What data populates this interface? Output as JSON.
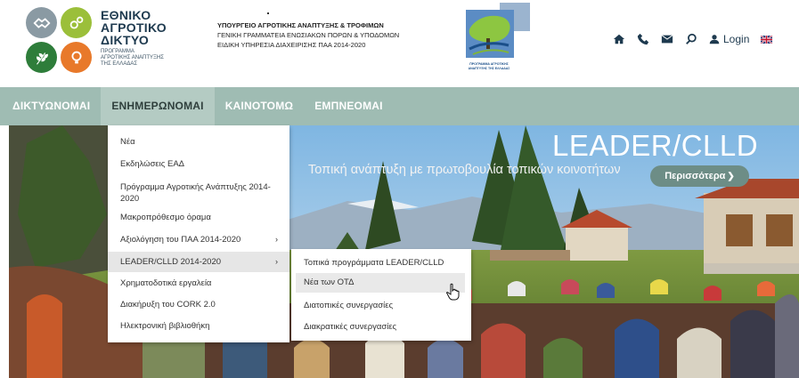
{
  "header": {
    "logo_title": [
      "ΕΘΝΙΚΟ",
      "ΑΓΡΟΤΙΚΟ",
      "ΔΙΚΤΥΟ"
    ],
    "logo_subtitle": [
      "ΠΡΟΓΡΑΜΜΑ",
      "ΑΓΡΟΤΙΚΗΣ ΑΝΑΠΤΥΞΗΣ",
      "ΤΗΣ ΕΛΛΑΔΑΣ"
    ],
    "ministry_line1": "ΥΠΟΥΡΓΕΙΟ ΑΓΡΟΤΙΚΗΣ ΑΝΑΠΤΥΞΗΣ & ΤΡΟΦΙΜΩΝ",
    "ministry_line2": "ΓΕΝΙΚΗ ΓΡΑΜΜΑΤΕΙΑ ΕΝΩΣΙΑΚΩΝ ΠΟΡΩΝ & ΥΠΟΔΟΜΩΝ",
    "ministry_line3": "ΕΙΔΙΚΗ ΥΠΗΡΕΣΙΑ ΔΙΑΧΕΙΡΙΣΗΣ ΠΑΑ 2014-2020",
    "emblem_caption": "ΠΡΟΓΡΑΜΜΑ ΑΓΡΟΤΙΚΗΣ ΑΝΑΠΤΥΞΗΣ ΤΗΣ ΕΛΛΑΔΑΣ",
    "login_label": "Login",
    "icons": [
      "home-icon",
      "phone-icon",
      "mail-icon",
      "search-icon",
      "user-icon",
      "uk-flag-icon"
    ],
    "logo_colors": [
      "#8a9aa3",
      "#9bbf3a",
      "#2e7d3a",
      "#e8792a"
    ]
  },
  "nav": {
    "items": [
      "ΔΙΚΤΥΩΝΟΜΑΙ",
      "ΕΝΗΜΕΡΩΝΟΜΑΙ",
      "ΚΑΙΝΟΤΟΜΩ",
      "ΕΜΠΝΕΟΜΑΙ"
    ],
    "active_index": 1,
    "bar_color": "#9fbcb3"
  },
  "hero": {
    "title": "LEADER/CLLD",
    "subtitle": "Τοπική ανάπτυξη με πρωτοβουλία τοπικών κοινοτήτων",
    "button_label": "Περισσότερα",
    "button_color": "#6d8d86"
  },
  "dropdown": {
    "items": [
      {
        "label": "Νέα",
        "has_submenu": false
      },
      {
        "label": "Εκδηλώσεις ΕΑΔ",
        "has_submenu": false
      },
      {
        "label": "Πρόγραμμα Αγροτικής Ανάπτυξης 2014-2020",
        "has_submenu": false
      },
      {
        "label": "Μακροπρόθεσμο όραμα",
        "has_submenu": false
      },
      {
        "label": "Αξιολόγηση του ΠΑΑ 2014-2020",
        "has_submenu": true
      },
      {
        "label": "LEADER/CLLD 2014-2020",
        "has_submenu": true
      },
      {
        "label": "Χρηματοδοτικά εργαλεία",
        "has_submenu": false
      },
      {
        "label": "Διακήρυξη του CORK 2.0",
        "has_submenu": false
      },
      {
        "label": "Ηλεκτρονική βιβλιοθήκη",
        "has_submenu": false
      }
    ],
    "highlighted_index": 5
  },
  "submenu": {
    "items": [
      "Τοπικά προγράμματα LEADER/CLLD",
      "Νέα των ΟΤΔ",
      "Διατοπικές συνεργασίες",
      "Διακρατικές συνεργασίες"
    ],
    "highlighted_index": 1
  }
}
